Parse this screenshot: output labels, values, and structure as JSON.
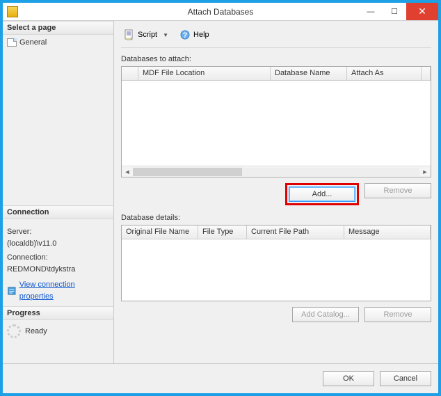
{
  "window": {
    "title": "Attach Databases"
  },
  "left": {
    "select_page_header": "Select a page",
    "pages": [
      "General"
    ],
    "connection_header": "Connection",
    "server_label": "Server:",
    "server_value": "(localdb)\\v11.0",
    "connection_label": "Connection:",
    "connection_value": "REDMOND\\tdykstra",
    "view_connection_link": "View connection properties",
    "progress_header": "Progress",
    "progress_status": "Ready"
  },
  "toolbar": {
    "script_label": "Script",
    "help_label": "Help"
  },
  "main": {
    "attach_label": "Databases to attach:",
    "attach_columns": {
      "c1": "MDF File Location",
      "c2": "Database Name",
      "c3": "Attach As"
    },
    "add_button": "Add...",
    "remove_button": "Remove",
    "details_label": "Database details:",
    "details_columns": {
      "d1": "Original File Name",
      "d2": "File Type",
      "d3": "Current File Path",
      "d4": "Message"
    },
    "add_catalog_button": "Add Catalog...",
    "remove2_button": "Remove"
  },
  "footer": {
    "ok": "OK",
    "cancel": "Cancel"
  }
}
